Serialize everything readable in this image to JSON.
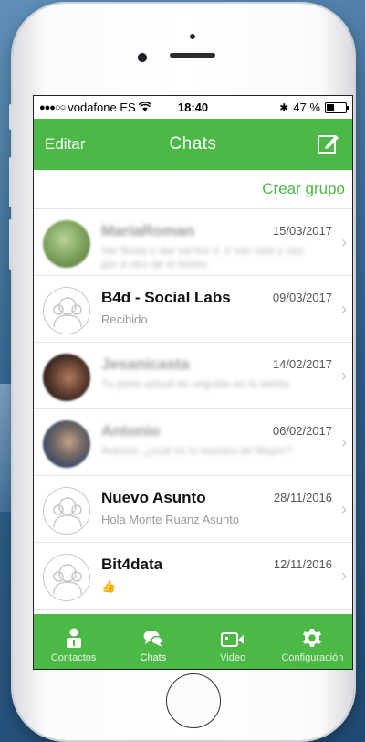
{
  "status": {
    "carrier": "vodafone ES",
    "time": "18:40",
    "battery": "47 %",
    "battery_level": 0.47
  },
  "nav": {
    "left": "Editar",
    "title": "Chats"
  },
  "create_group": "Crear grupo",
  "chats": [
    {
      "name": "MariaRoman",
      "preview": "Ver fiesta o dar sol fue ir, ir van vida y vez por a otro de el hesim",
      "date": "15/03/2017",
      "avatar": "photo-green",
      "blurred": true
    },
    {
      "name": "B4d - Social Labs",
      "preview": "Recibido",
      "date": "09/03/2017",
      "avatar": "default",
      "blurred": false
    },
    {
      "name": "Jesanicasta",
      "preview": "Tu pone actual de seguida en la vienta",
      "date": "14/02/2017",
      "avatar": "photo-face",
      "blurred": true
    },
    {
      "name": "Antonio",
      "preview": "Antonio, ¿cual es lo nuestra de Mayor?",
      "date": "06/02/2017",
      "avatar": "photo-person",
      "blurred": true
    },
    {
      "name": "Nuevo Asunto",
      "preview": "Hola Monte Ruanz Asunto",
      "date": "28/11/2016",
      "avatar": "default",
      "blurred": false
    },
    {
      "name": "Bit4data",
      "preview": "👍",
      "date": "12/11/2016",
      "avatar": "default",
      "blurred": false
    }
  ],
  "tabs": [
    {
      "label": "Contactos",
      "icon": "contacts-icon",
      "active": false
    },
    {
      "label": "Chats",
      "icon": "chats-icon",
      "active": true
    },
    {
      "label": "Video",
      "icon": "video-icon",
      "active": false
    },
    {
      "label": "Configuración",
      "icon": "settings-icon",
      "active": false
    }
  ],
  "colors": {
    "brand_green": "#4cb947",
    "text_gray": "#9a9a9a"
  }
}
